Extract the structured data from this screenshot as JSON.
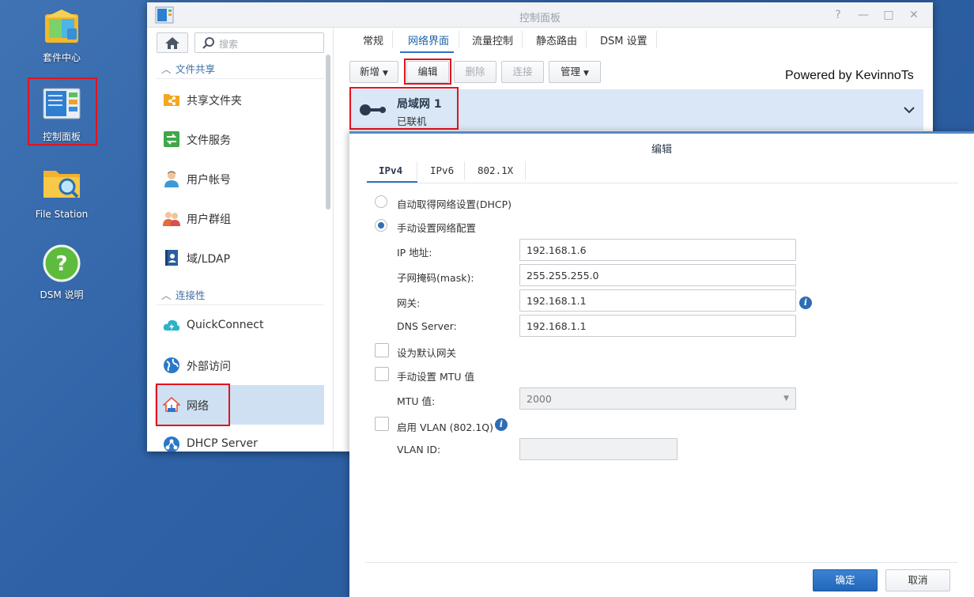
{
  "desktop": {
    "icons": [
      {
        "label": "套件中心"
      },
      {
        "label": "控制面板"
      },
      {
        "label": "File Station"
      },
      {
        "label": "DSM 说明"
      }
    ]
  },
  "window": {
    "title": "控制面板",
    "controls": {
      "help": "?",
      "minimize": "—",
      "maximize": "□",
      "close": "✕"
    }
  },
  "sidebar": {
    "search_placeholder": "搜索",
    "sections": [
      {
        "title": "文件共享"
      },
      {
        "title": "连接性"
      }
    ],
    "items": [
      {
        "label": "共享文件夹",
        "icon": "shared-folder-icon"
      },
      {
        "label": "文件服务",
        "icon": "file-services-icon"
      },
      {
        "label": "用户帐号",
        "icon": "user-icon"
      },
      {
        "label": "用户群组",
        "icon": "group-icon"
      },
      {
        "label": "域/LDAP",
        "icon": "ldap-icon"
      },
      {
        "label": "QuickConnect",
        "icon": "quickconnect-icon"
      },
      {
        "label": "外部访问",
        "icon": "external-access-icon"
      },
      {
        "label": "网络",
        "icon": "network-icon"
      },
      {
        "label": "DHCP Server",
        "icon": "dhcp-icon"
      }
    ]
  },
  "tabs": [
    "常规",
    "网络界面",
    "流量控制",
    "静态路由",
    "DSM 设置"
  ],
  "active_tab": "网络界面",
  "toolbar": {
    "create": "新增",
    "edit": "编辑",
    "delete": "删除",
    "connect": "连接",
    "manage": "管理"
  },
  "watermark": "Powered by KevinnoTs",
  "interface": {
    "name": "局域网 1",
    "status": "已联机"
  },
  "dialog": {
    "title": "编辑",
    "tabs": [
      "IPv4",
      "IPv6",
      "802.1X"
    ],
    "active_tab": "IPv4",
    "dhcp_label": "自动取得网络设置(DHCP)",
    "manual_label": "手动设置网络配置",
    "ip_label": "IP 地址:",
    "ip_value": "192.168.1.6",
    "mask_label": "子网掩码(mask):",
    "mask_value": "255.255.255.0",
    "gateway_label": "网关:",
    "gateway_value": "192.168.1.1",
    "dns_label": "DNS Server:",
    "dns_value": "192.168.1.1",
    "default_gateway_label": "设为默认网关",
    "manual_mtu_label": "手动设置 MTU 值",
    "mtu_label": "MTU 值:",
    "mtu_value": "2000",
    "vlan_label": "启用 VLAN (802.1Q)",
    "vlan_id_label": "VLAN ID:",
    "vlan_id_value": "",
    "ok": "确定",
    "cancel": "取消"
  },
  "colors": {
    "desktop_bg": "#2e62a6",
    "accent": "#2f72c4",
    "highlight_box": "#e0141e",
    "selected_row": "#d9e7f6"
  }
}
